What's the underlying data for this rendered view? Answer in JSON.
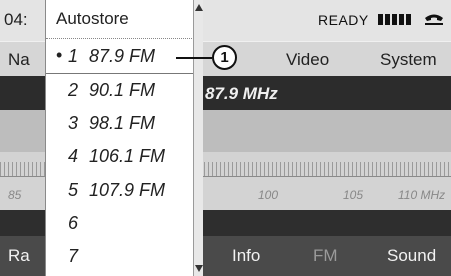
{
  "status_bar": {
    "time_partial": "04:",
    "ready_label": "READY"
  },
  "menu": {
    "left_partial": "Na",
    "items": [
      "Video",
      "System"
    ]
  },
  "station": {
    "frequency": "87.9 MHz"
  },
  "scale": {
    "ticks": [
      "85",
      "100",
      "105",
      "110 MHz"
    ]
  },
  "bottom_bar": {
    "left_partial": "Ra",
    "items": [
      "Info",
      "FM",
      "Sound"
    ],
    "active": "FM"
  },
  "dropdown": {
    "title": "Autostore",
    "items": [
      {
        "bullet": "•",
        "preset": "1",
        "frequency": "87.9 FM"
      },
      {
        "bullet": "",
        "preset": "2",
        "frequency": "90.1 FM"
      },
      {
        "bullet": "",
        "preset": "3",
        "frequency": "98.1 FM"
      },
      {
        "bullet": "",
        "preset": "4",
        "frequency": "106.1 FM"
      },
      {
        "bullet": "",
        "preset": "5",
        "frequency": "107.9 FM"
      },
      {
        "bullet": "",
        "preset": "6",
        "frequency": ""
      },
      {
        "bullet": "",
        "preset": "7",
        "frequency": ""
      }
    ]
  },
  "callout": {
    "label": "1"
  },
  "icons": {
    "signal": "signal-strength-icon",
    "phone": "phone-handset-icon",
    "scroll_up": "scroll-up-arrow-icon",
    "scroll_down": "scroll-down-arrow-icon"
  },
  "colors": {
    "active_tab": "#9a9a9a",
    "frequency_bar": "#2c2c2c"
  }
}
